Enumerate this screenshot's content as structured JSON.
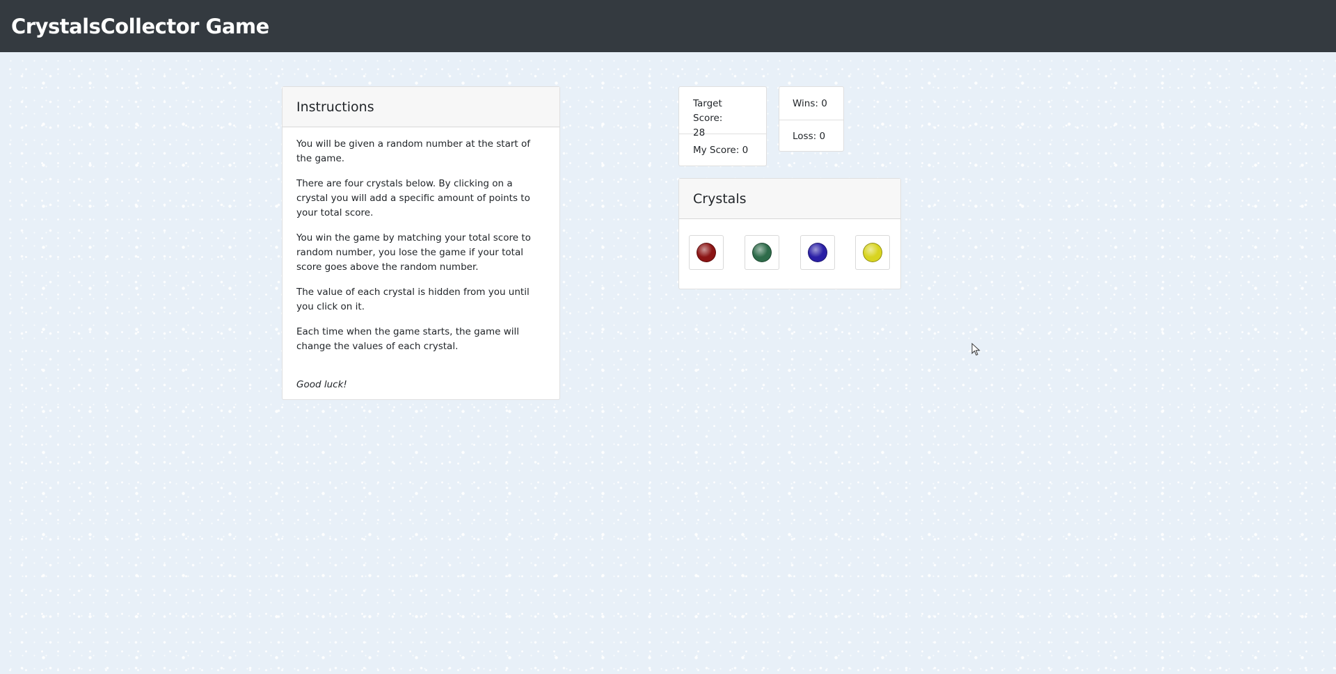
{
  "navbar": {
    "brand": "CrystalsCollector Game"
  },
  "instructions": {
    "title": "Instructions",
    "paragraphs": [
      "You will be given a random number at the start of the game.",
      "There are four crystals below. By clicking on a crystal you will add a specific amount of points to your total score.",
      "You win the game by matching your total score to random number, you lose the game if your total score goes above the random number.",
      "The value of each crystal is hidden from you until you click on it.",
      "Each time when the game starts, the game will change the values of each crystal."
    ],
    "closing": "Good luck!"
  },
  "score": {
    "target_label": "Target Score:",
    "target_value": "28",
    "my_score_label": "My Score: 0"
  },
  "record": {
    "wins_label": "Wins: 0",
    "loss_label": "Loss: 0"
  },
  "crystals": {
    "title": "Crystals",
    "items": [
      {
        "name": "red-crystal",
        "color": "#8b1414"
      },
      {
        "name": "green-crystal",
        "color": "#2e6b4a"
      },
      {
        "name": "blue-crystal",
        "color": "#2a1fa6"
      },
      {
        "name": "yellow-crystal",
        "color": "#d8d420"
      }
    ]
  },
  "colors": {
    "navbar_bg": "#343a40",
    "page_bg": "#e8f0f8",
    "card_header_bg": "#f7f7f7"
  }
}
